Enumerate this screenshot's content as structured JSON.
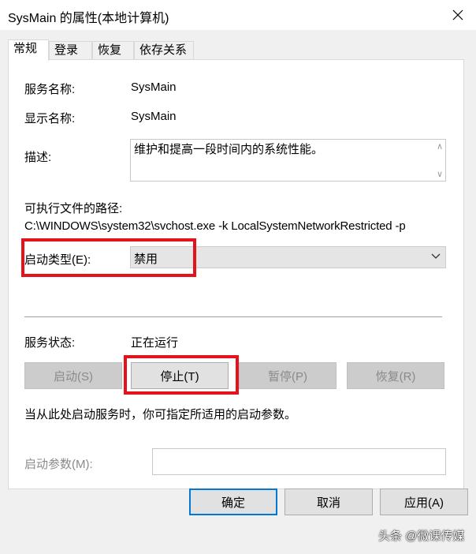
{
  "window": {
    "title": "SysMain 的属性(本地计算机)"
  },
  "tabs": [
    {
      "label": "常规"
    },
    {
      "label": "登录"
    },
    {
      "label": "恢复"
    },
    {
      "label": "依存关系"
    }
  ],
  "general": {
    "service_name_label": "服务名称:",
    "service_name_value": "SysMain",
    "display_name_label": "显示名称:",
    "display_name_value": "SysMain",
    "description_label": "描述:",
    "description_value": "维护和提高一段时间内的系统性能。",
    "exe_path_label": "可执行文件的路径:",
    "exe_path_value": "C:\\WINDOWS\\system32\\svchost.exe -k LocalSystemNetworkRestricted -p",
    "startup_type_label": "启动类型(E):",
    "startup_type_value": "禁用",
    "status_label": "服务状态:",
    "status_value": "正在运行",
    "buttons": {
      "start": "启动(S)",
      "stop": "停止(T)",
      "pause": "暂停(P)",
      "resume": "恢复(R)"
    },
    "hint": "当从此处启动服务时，你可指定所适用的启动参数。",
    "start_params_label": "启动参数(M):",
    "start_params_value": ""
  },
  "footer": {
    "ok": "确定",
    "cancel": "取消",
    "apply": "应用(A)"
  },
  "watermark": "头条 @微课传媒",
  "colors": {
    "highlight": "#e3121b",
    "accent": "#0078d7"
  }
}
